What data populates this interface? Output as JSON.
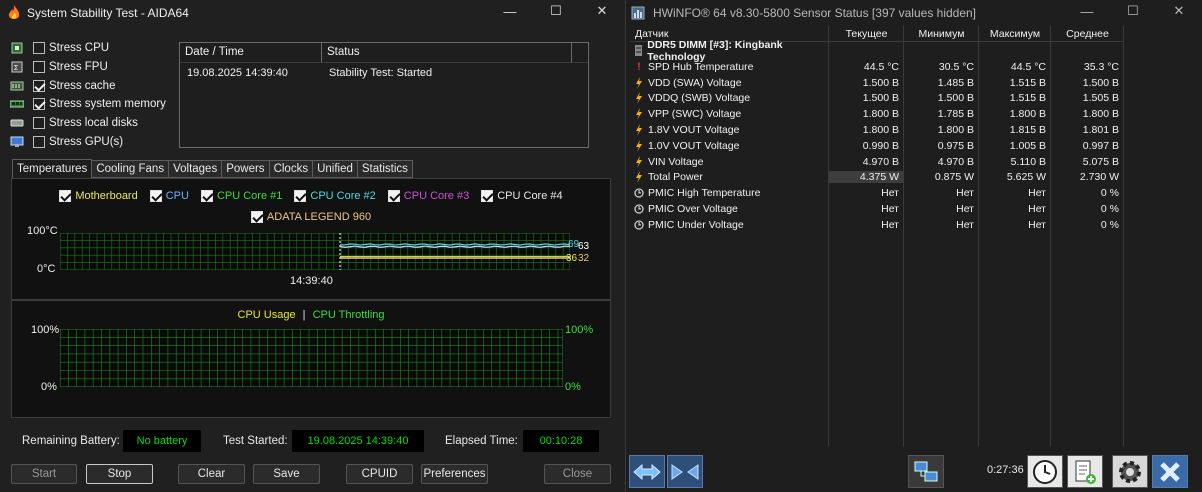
{
  "aida": {
    "title": "System Stability Test - AIDA64",
    "stress": [
      {
        "label": "Stress CPU",
        "checked": false,
        "icon": "cpu-chip-icon"
      },
      {
        "label": "Stress FPU",
        "checked": false,
        "icon": "fpu-chip-icon"
      },
      {
        "label": "Stress cache",
        "checked": true,
        "icon": "cache-icon"
      },
      {
        "label": "Stress system memory",
        "checked": true,
        "icon": "memory-module-icon"
      },
      {
        "label": "Stress local disks",
        "checked": false,
        "icon": "disk-drive-icon"
      },
      {
        "label": "Stress GPU(s)",
        "checked": false,
        "icon": "gpu-monitor-icon"
      }
    ],
    "log": {
      "col_date": "Date / Time",
      "col_status": "Status",
      "rows": [
        {
          "date": "19.08.2025 14:39:40",
          "status": "Stability Test: Started"
        }
      ]
    },
    "tabs": [
      "Temperatures",
      "Cooling Fans",
      "Voltages",
      "Powers",
      "Clocks",
      "Unified",
      "Statistics"
    ],
    "active_tab": "Temperatures",
    "temp_legend": [
      {
        "label": "Motherboard",
        "color": "#e8e85a",
        "checked": true
      },
      {
        "label": "CPU",
        "color": "#6ab4ff",
        "checked": true
      },
      {
        "label": "CPU Core #1",
        "color": "#3cdc3c",
        "checked": true
      },
      {
        "label": "CPU Core #2",
        "color": "#4fd8e0",
        "checked": true
      },
      {
        "label": "CPU Core #3",
        "color": "#d050d8",
        "checked": true
      },
      {
        "label": "CPU Core #4",
        "color": "#e8e8e8",
        "checked": true
      },
      {
        "label": "ADATA LEGEND 960",
        "color": "#e8c88a",
        "checked": true
      }
    ],
    "temp_graph": {
      "y_max_label": "100°C",
      "y_min_label": "0°C",
      "time_label": "14:39:40",
      "value_labels": [
        {
          "text": "69",
          "color": "#4fd8e0"
        },
        {
          "text": "63",
          "color": "#ffffff"
        },
        {
          "text": "36",
          "color": "#e8e85a"
        },
        {
          "text": "32",
          "color": "#e8c88a"
        }
      ],
      "series": [
        {
          "name": "Motherboard",
          "color": "#e8e85a",
          "value": 36
        },
        {
          "name": "ADATA LEGEND 960",
          "color": "#e8c88a",
          "value": 32
        },
        {
          "name": "CPU Core #2",
          "color": "#4fd8e0",
          "value": 69
        },
        {
          "name": "CPU",
          "color": "#cfcfff",
          "value": 63
        }
      ]
    },
    "usage_graph": {
      "legend_usage": "CPU Usage",
      "legend_sep": "|",
      "legend_throttling": "CPU Throttling",
      "usage_color": "#e8e82a",
      "throttle_color": "#3cdc3c",
      "left_top": "100%",
      "left_bottom": "0%",
      "right_top": "100%",
      "right_bottom": "0%"
    },
    "status": {
      "battery_label": "Remaining Battery:",
      "battery_value": "No battery",
      "started_label": "Test Started:",
      "started_value": "19.08.2025 14:39:40",
      "elapsed_label": "Elapsed Time:",
      "elapsed_value": "00:10:28"
    },
    "buttons": {
      "start": "Start",
      "stop": "Stop",
      "clear": "Clear",
      "save": "Save",
      "cpuid": "CPUID",
      "preferences": "Preferences",
      "close": "Close"
    }
  },
  "hwinfo": {
    "title": "HWiNFO® 64 v8.30-5800 Sensor Status [397 values hidden]",
    "columns": [
      "Датчик",
      "Текущее",
      "Минимум",
      "Максимум",
      "Среднее"
    ],
    "group": "DDR5 DIMM [#3]: Kingbank Technology",
    "rows": [
      {
        "name": "SPD Hub Temperature",
        "icon": "temperature-icon",
        "cur": "44.5 °C",
        "min": "30.5 °C",
        "max": "44.5 °C",
        "avg": "35.3 °C"
      },
      {
        "name": "VDD (SWA) Voltage",
        "icon": "voltage-icon",
        "cur": "1.500 В",
        "min": "1.485 В",
        "max": "1.515 В",
        "avg": "1.500 В"
      },
      {
        "name": "VDDQ (SWB) Voltage",
        "icon": "voltage-icon",
        "cur": "1.500 В",
        "min": "1.500 В",
        "max": "1.515 В",
        "avg": "1.505 В"
      },
      {
        "name": "VPP (SWC) Voltage",
        "icon": "voltage-icon",
        "cur": "1.800 В",
        "min": "1.785 В",
        "max": "1.800 В",
        "avg": "1.800 В"
      },
      {
        "name": "1.8V VOUT Voltage",
        "icon": "voltage-icon",
        "cur": "1.800 В",
        "min": "1.800 В",
        "max": "1.815 В",
        "avg": "1.801 В"
      },
      {
        "name": "1.0V VOUT Voltage",
        "icon": "voltage-icon",
        "cur": "0.990 В",
        "min": "0.975 В",
        "max": "1.005 В",
        "avg": "0.997 В"
      },
      {
        "name": "VIN Voltage",
        "icon": "voltage-icon",
        "cur": "4.970 В",
        "min": "4.970 В",
        "max": "5.110 В",
        "avg": "5.075 В"
      },
      {
        "name": "Total Power",
        "icon": "power-icon",
        "cur": "4.375 W",
        "min": "0.875 W",
        "max": "5.625 W",
        "avg": "2.730 W"
      },
      {
        "name": "PMIC High Temperature",
        "icon": "status-icon",
        "cur": "Нет",
        "min": "Нет",
        "max": "Нет",
        "avg": "0 %"
      },
      {
        "name": "PMIC Over Voltage",
        "icon": "status-icon",
        "cur": "Нет",
        "min": "Нет",
        "max": "Нет",
        "avg": "0 %"
      },
      {
        "name": "PMIC Under Voltage",
        "icon": "status-icon",
        "cur": "Нет",
        "min": "Нет",
        "max": "Нет",
        "avg": "0 %"
      }
    ],
    "elapsed": "0:27:36"
  }
}
